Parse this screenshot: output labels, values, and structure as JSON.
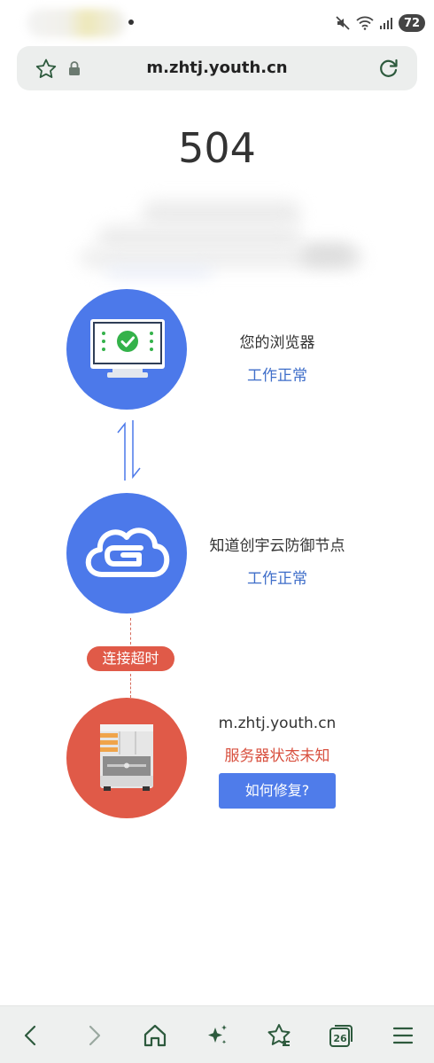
{
  "status_bar": {
    "battery": "72"
  },
  "address_bar": {
    "url": "m.zhtj.youth.cn"
  },
  "page": {
    "error_code": "504",
    "nodes": [
      {
        "name": "您的浏览器",
        "status": "工作正常"
      },
      {
        "name": "知道创宇云防御节点",
        "status": "工作正常"
      },
      {
        "name": "m.zhtj.youth.cn",
        "status": "服务器状态未知"
      }
    ],
    "timeout_label": "连接超时",
    "fix_button": "如何修复?"
  },
  "bottom_nav": {
    "tab_count": "26",
    "icons": [
      "back-icon",
      "forward-icon",
      "home-icon",
      "sparkle-icon",
      "favorites-icon",
      "tabs-icon",
      "menu-icon"
    ]
  },
  "colors": {
    "blue": "#4c79ea",
    "red": "#e05a48",
    "ok_text": "#3f6ec9",
    "error_text": "#d8503f",
    "icon_green": "#2d5a3d"
  }
}
